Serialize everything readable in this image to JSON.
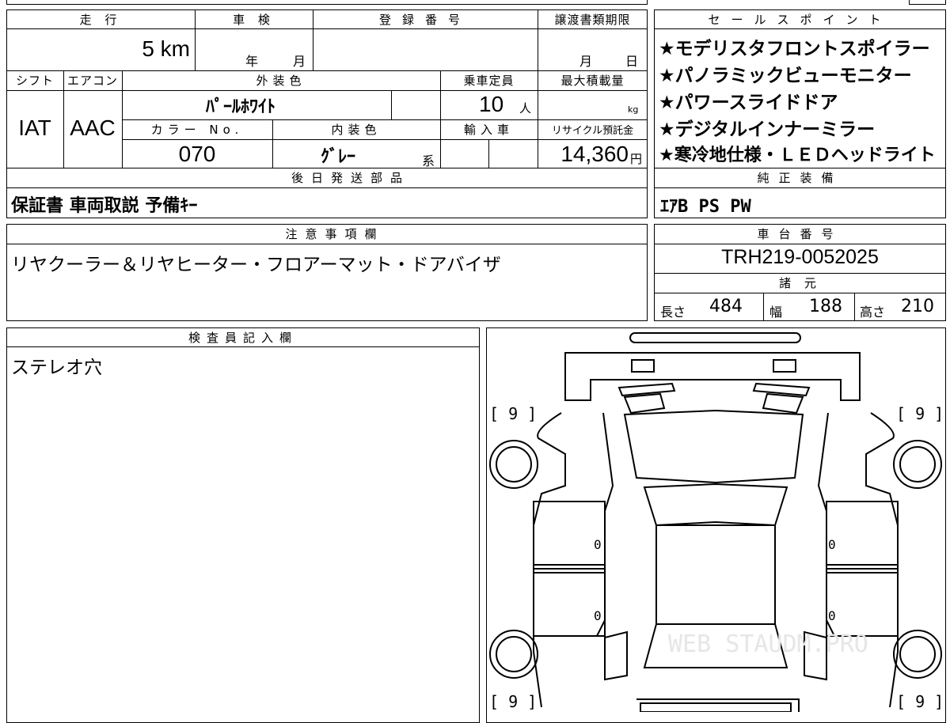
{
  "header": {
    "mileage_label": "走 行",
    "mileage_value": "5 km",
    "inspection_label": "車 検",
    "inspection_year": "年",
    "inspection_month": "月",
    "registration_label": "登録番号",
    "registration_value": "",
    "transfer_label": "譲渡書類期限",
    "transfer_month": "月",
    "transfer_day": "日"
  },
  "specs": {
    "shift_label": "シフト",
    "shift_value": "IAT",
    "aircon_label": "エアコン",
    "aircon_value": "AAC",
    "exterior_label": "外装色",
    "exterior_value": "ﾊﾟｰﾙﾎﾜｲﾄ",
    "capacity_label": "乗車定員",
    "capacity_value": "10",
    "capacity_unit": "人",
    "max_load_label": "最大積載量",
    "max_load_unit": "kg",
    "color_no_label": "カラー No.",
    "color_no_value": "070",
    "interior_label": "内装色",
    "interior_value": "ｸﾞﾚｰ",
    "interior_suffix": "系",
    "import_label": "輸入車",
    "recycle_label": "リサイクル預託金",
    "recycle_value": "14,360",
    "recycle_unit": "円"
  },
  "later_parts": {
    "label": "後日発送部品",
    "value": "保証書 車両取説 予備ｷｰ"
  },
  "sales_points": {
    "label": "セールスポイント",
    "items": [
      "★モデリスタフロントスポイラー",
      "★パノラミックビューモニター",
      "★パワースライドドア",
      "★デジタルインナーミラー",
      "★寒冷地仕様・ＬＥＤヘッドライト"
    ]
  },
  "genuine_equipment": {
    "label": "純正装備",
    "value": "ｴｱB PS PW"
  },
  "notes": {
    "label": "注意事項欄",
    "value": "リヤクーラー＆リヤヒーター・フロアーマット・ドアバイザ"
  },
  "chassis": {
    "label": "車台番号",
    "value": "TRH219-0052025"
  },
  "dimensions": {
    "label": "諸 元",
    "length_label": "長さ",
    "length_value": "484",
    "width_label": "幅",
    "width_value": "188",
    "height_label": "高さ",
    "height_value": "210"
  },
  "inspector": {
    "label": "検査員記入欄",
    "value": "ステレオ穴"
  },
  "diagram": {
    "tire_front_left": "[ 9 ]",
    "tire_front_right": "[ 9 ]",
    "tire_rear_left": "[ 9 ]",
    "tire_rear_right": "[ 9 ]",
    "door_marks": [
      "0",
      "0",
      "0",
      "0"
    ],
    "watermark": "WEB STAUDM.PRO"
  }
}
